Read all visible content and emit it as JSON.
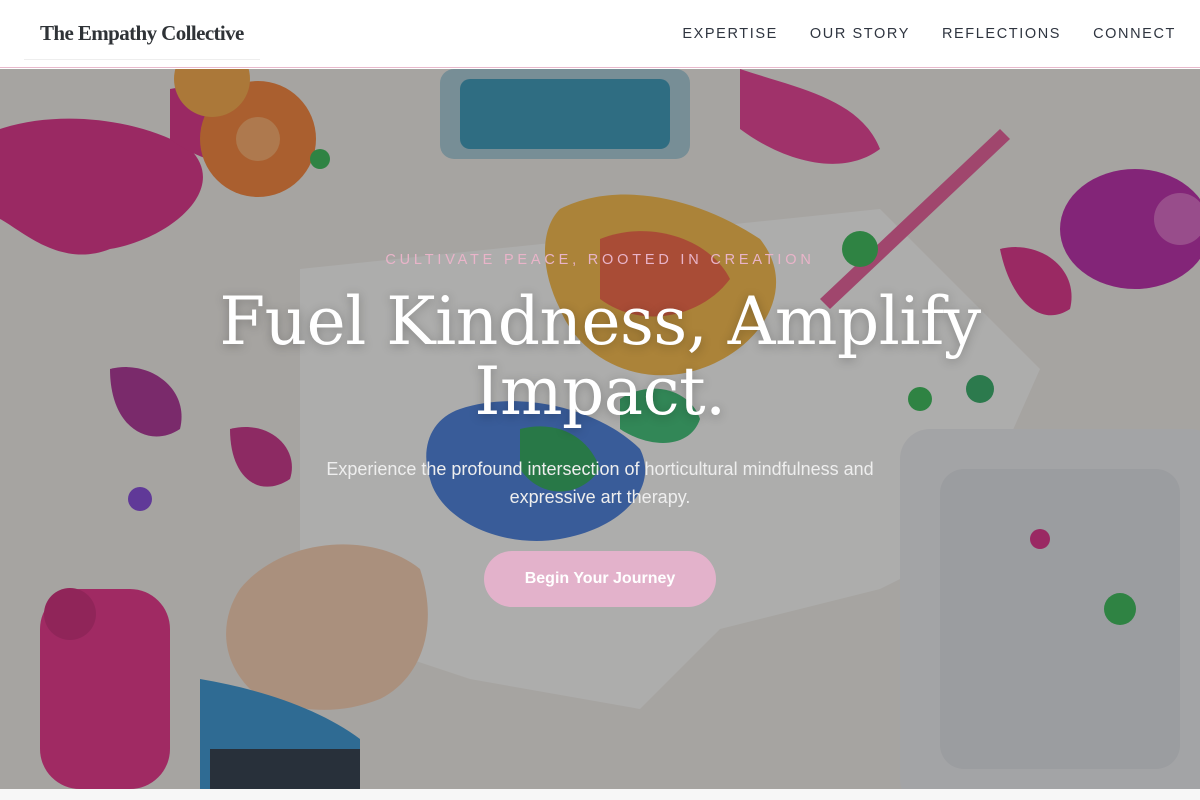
{
  "brand": {
    "name": "The Empathy Collective"
  },
  "nav": {
    "items": [
      {
        "label": "EXPERTISE"
      },
      {
        "label": "OUR STORY"
      },
      {
        "label": "REFLECTIONS"
      },
      {
        "label": "CONNECT"
      }
    ]
  },
  "hero": {
    "eyebrow": "CULTIVATE PEACE, ROOTED IN CREATION",
    "headline": "Fuel Kindness, Amplify Impact.",
    "subtext": "Experience the profound intersection of horticultural mindfulness and expressive art therapy.",
    "cta_label": "Begin Your Journey"
  },
  "colors": {
    "accent_pink": "#e3b2cb",
    "eyebrow_pink": "#e9b4c9",
    "nav_text": "#2f3540",
    "logo_text": "#2f3337"
  }
}
